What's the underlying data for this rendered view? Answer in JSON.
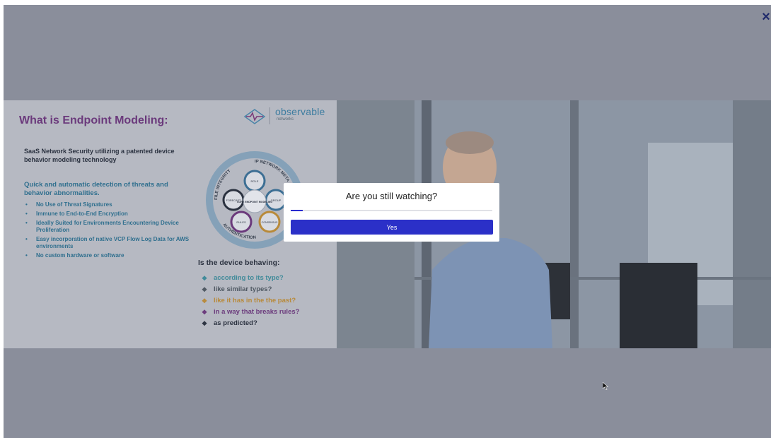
{
  "close_label": "×",
  "slide": {
    "title": "What is Endpoint Modeling:",
    "logo_text": "observable",
    "logo_sub": "networks",
    "intro": "SaaS Network Security utilizing a patented device behavior modeling technology",
    "subhead": "Quick and automatic detection of threats and behavior abnormalities.",
    "bullets": [
      "No Use of Threat Signatures",
      "Immune to End-to-End Encryption",
      "Ideally Suited for Environments Encountering Device Proliferation",
      "Easy incorporation of native VCP Flow Log Data for AWS environments",
      "No custom hardware or software"
    ],
    "device_question": "Is the device behaving:",
    "questions": [
      "according to its type?",
      "like similar types?",
      "like it has in the the past?",
      "in a way that breaks rules?",
      "as predicted?"
    ],
    "diagram_labels": {
      "ring_top": "FILE INTEGRITY",
      "ring_right": "IP NETWORK META",
      "ring_bottom": "AUTHENTICATION",
      "center": "CORE ENDPOINT MODELING",
      "nodes": [
        "ROLE",
        "GROUP",
        "CONSENSUS",
        "RULES",
        "FORECAST"
      ]
    },
    "colors": {
      "title": "#6b3a7c",
      "accent": "#2f6f8e"
    }
  },
  "modal": {
    "title": "Are you still watching?",
    "progress": 0.06,
    "yes_label": "Yes",
    "button_color": "#2b30c8"
  }
}
